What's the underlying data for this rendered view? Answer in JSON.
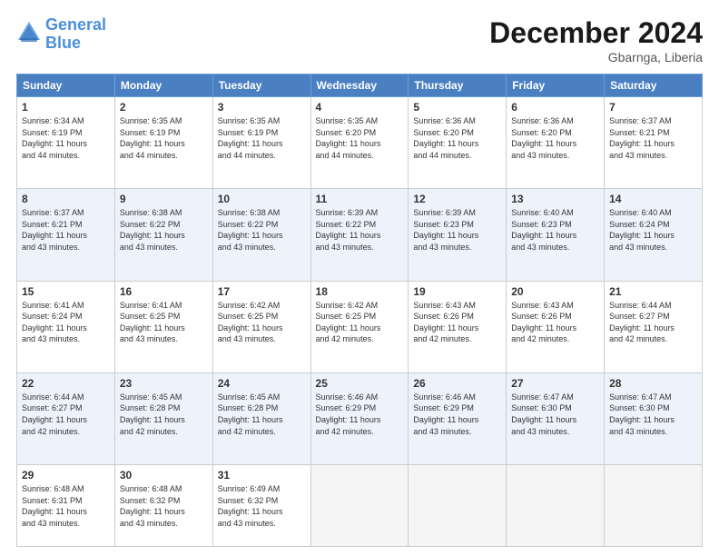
{
  "header": {
    "logo_line1": "General",
    "logo_line2": "Blue",
    "month": "December 2024",
    "location": "Gbarnga, Liberia"
  },
  "days_of_week": [
    "Sunday",
    "Monday",
    "Tuesday",
    "Wednesday",
    "Thursday",
    "Friday",
    "Saturday"
  ],
  "weeks": [
    [
      {
        "day": 1,
        "info": "Sunrise: 6:34 AM\nSunset: 6:19 PM\nDaylight: 11 hours\nand 44 minutes."
      },
      {
        "day": 2,
        "info": "Sunrise: 6:35 AM\nSunset: 6:19 PM\nDaylight: 11 hours\nand 44 minutes."
      },
      {
        "day": 3,
        "info": "Sunrise: 6:35 AM\nSunset: 6:19 PM\nDaylight: 11 hours\nand 44 minutes."
      },
      {
        "day": 4,
        "info": "Sunrise: 6:35 AM\nSunset: 6:20 PM\nDaylight: 11 hours\nand 44 minutes."
      },
      {
        "day": 5,
        "info": "Sunrise: 6:36 AM\nSunset: 6:20 PM\nDaylight: 11 hours\nand 44 minutes."
      },
      {
        "day": 6,
        "info": "Sunrise: 6:36 AM\nSunset: 6:20 PM\nDaylight: 11 hours\nand 43 minutes."
      },
      {
        "day": 7,
        "info": "Sunrise: 6:37 AM\nSunset: 6:21 PM\nDaylight: 11 hours\nand 43 minutes."
      }
    ],
    [
      {
        "day": 8,
        "info": "Sunrise: 6:37 AM\nSunset: 6:21 PM\nDaylight: 11 hours\nand 43 minutes."
      },
      {
        "day": 9,
        "info": "Sunrise: 6:38 AM\nSunset: 6:22 PM\nDaylight: 11 hours\nand 43 minutes."
      },
      {
        "day": 10,
        "info": "Sunrise: 6:38 AM\nSunset: 6:22 PM\nDaylight: 11 hours\nand 43 minutes."
      },
      {
        "day": 11,
        "info": "Sunrise: 6:39 AM\nSunset: 6:22 PM\nDaylight: 11 hours\nand 43 minutes."
      },
      {
        "day": 12,
        "info": "Sunrise: 6:39 AM\nSunset: 6:23 PM\nDaylight: 11 hours\nand 43 minutes."
      },
      {
        "day": 13,
        "info": "Sunrise: 6:40 AM\nSunset: 6:23 PM\nDaylight: 11 hours\nand 43 minutes."
      },
      {
        "day": 14,
        "info": "Sunrise: 6:40 AM\nSunset: 6:24 PM\nDaylight: 11 hours\nand 43 minutes."
      }
    ],
    [
      {
        "day": 15,
        "info": "Sunrise: 6:41 AM\nSunset: 6:24 PM\nDaylight: 11 hours\nand 43 minutes."
      },
      {
        "day": 16,
        "info": "Sunrise: 6:41 AM\nSunset: 6:25 PM\nDaylight: 11 hours\nand 43 minutes."
      },
      {
        "day": 17,
        "info": "Sunrise: 6:42 AM\nSunset: 6:25 PM\nDaylight: 11 hours\nand 43 minutes."
      },
      {
        "day": 18,
        "info": "Sunrise: 6:42 AM\nSunset: 6:25 PM\nDaylight: 11 hours\nand 42 minutes."
      },
      {
        "day": 19,
        "info": "Sunrise: 6:43 AM\nSunset: 6:26 PM\nDaylight: 11 hours\nand 42 minutes."
      },
      {
        "day": 20,
        "info": "Sunrise: 6:43 AM\nSunset: 6:26 PM\nDaylight: 11 hours\nand 42 minutes."
      },
      {
        "day": 21,
        "info": "Sunrise: 6:44 AM\nSunset: 6:27 PM\nDaylight: 11 hours\nand 42 minutes."
      }
    ],
    [
      {
        "day": 22,
        "info": "Sunrise: 6:44 AM\nSunset: 6:27 PM\nDaylight: 11 hours\nand 42 minutes."
      },
      {
        "day": 23,
        "info": "Sunrise: 6:45 AM\nSunset: 6:28 PM\nDaylight: 11 hours\nand 42 minutes."
      },
      {
        "day": 24,
        "info": "Sunrise: 6:45 AM\nSunset: 6:28 PM\nDaylight: 11 hours\nand 42 minutes."
      },
      {
        "day": 25,
        "info": "Sunrise: 6:46 AM\nSunset: 6:29 PM\nDaylight: 11 hours\nand 42 minutes."
      },
      {
        "day": 26,
        "info": "Sunrise: 6:46 AM\nSunset: 6:29 PM\nDaylight: 11 hours\nand 43 minutes."
      },
      {
        "day": 27,
        "info": "Sunrise: 6:47 AM\nSunset: 6:30 PM\nDaylight: 11 hours\nand 43 minutes."
      },
      {
        "day": 28,
        "info": "Sunrise: 6:47 AM\nSunset: 6:30 PM\nDaylight: 11 hours\nand 43 minutes."
      }
    ],
    [
      {
        "day": 29,
        "info": "Sunrise: 6:48 AM\nSunset: 6:31 PM\nDaylight: 11 hours\nand 43 minutes."
      },
      {
        "day": 30,
        "info": "Sunrise: 6:48 AM\nSunset: 6:32 PM\nDaylight: 11 hours\nand 43 minutes."
      },
      {
        "day": 31,
        "info": "Sunrise: 6:49 AM\nSunset: 6:32 PM\nDaylight: 11 hours\nand 43 minutes."
      },
      null,
      null,
      null,
      null
    ]
  ]
}
